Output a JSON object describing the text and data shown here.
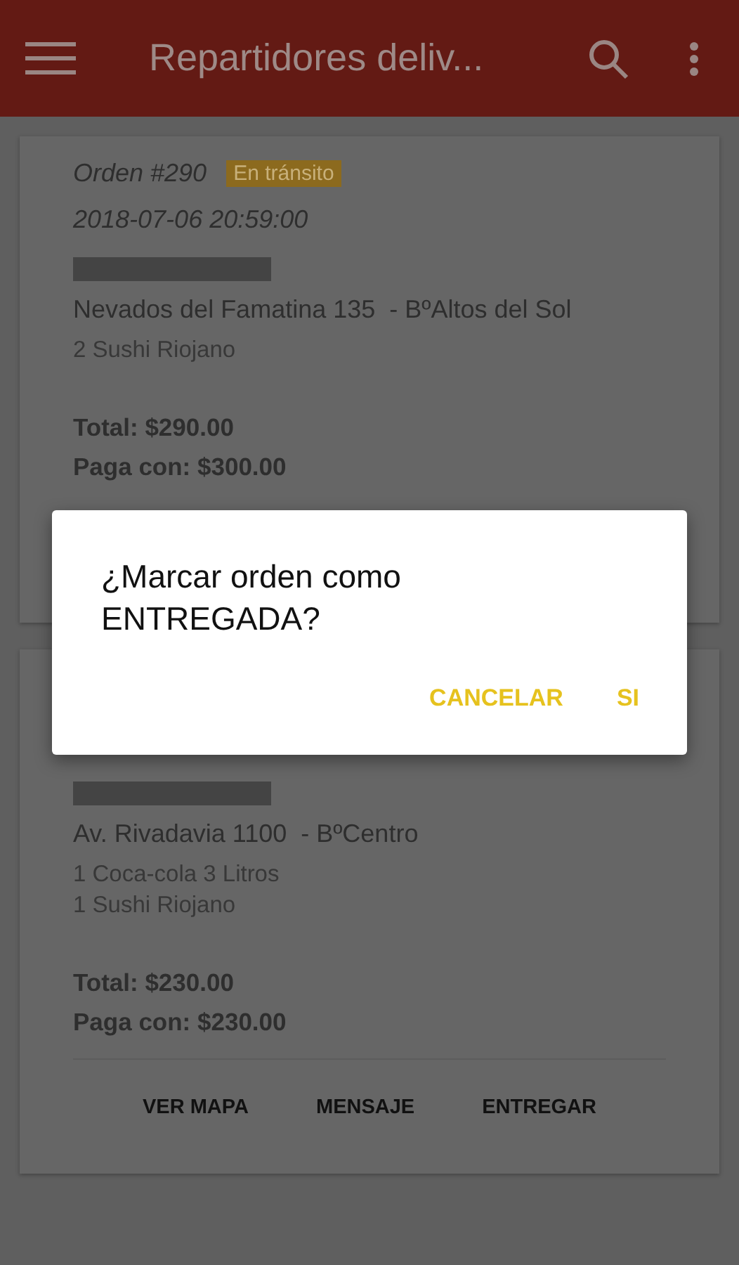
{
  "app_bar": {
    "title": "Repartidores deliv..."
  },
  "orders": [
    {
      "order": "Orden #290",
      "status": "En tránsito",
      "datetime": "2018-07-06 20:59:00",
      "address": "Nevados del Famatina 135  - BºAltos del Sol",
      "items": [
        "2 Sushi Riojano"
      ],
      "total": "Total: $290.00",
      "pays_with": "Paga con: $300.00"
    },
    {
      "address": "Av. Rivadavia 1100  - BºCentro",
      "items": [
        "1 Coca-cola 3 Litros",
        "1 Sushi Riojano"
      ],
      "total": "Total: $230.00",
      "pays_with": "Paga con: $230.00",
      "actions": [
        "VER MAPA",
        "MENSAJE",
        "ENTREGAR"
      ]
    }
  ],
  "dialog": {
    "message": "¿Marcar orden como ENTREGADA?",
    "buttons": [
      "CANCELAR",
      "SI"
    ]
  }
}
